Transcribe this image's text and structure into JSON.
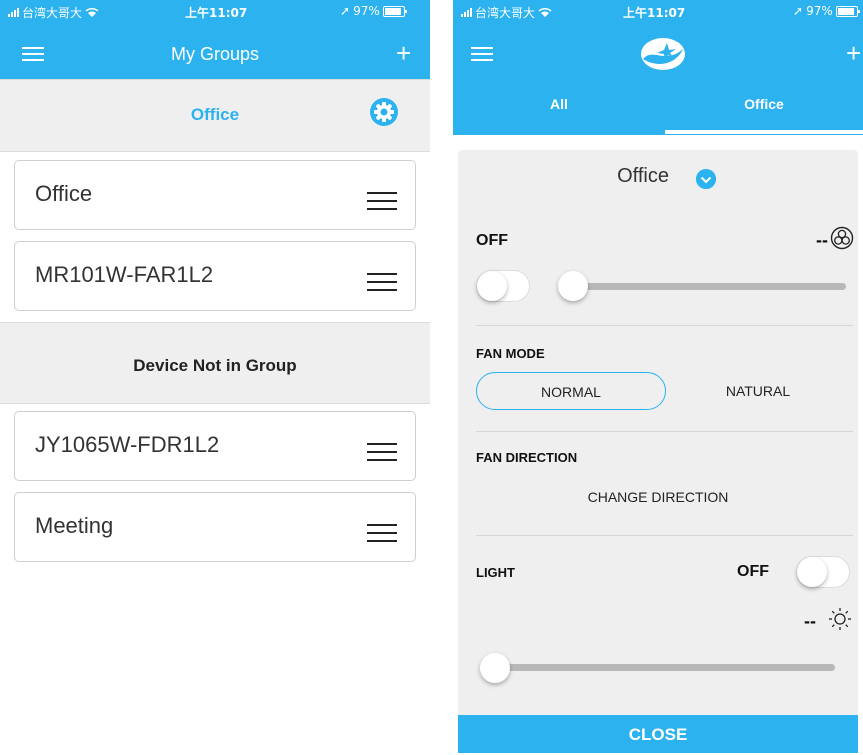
{
  "left_screen": {
    "status_bar": {
      "carrier": "台湾大哥大",
      "time": "上午11:07",
      "battery": "97%"
    },
    "header": {
      "title": "My Groups",
      "menu_icon": "hamburger-icon",
      "add_icon": "plus-icon"
    },
    "group_section": {
      "title": "Office",
      "settings_icon": "gear-icon"
    },
    "group_devices": [
      {
        "name": "Office"
      },
      {
        "name": "MR101W-FAR1L2"
      }
    ],
    "ungrouped_section": {
      "title": "Device Not in Group"
    },
    "ungrouped_devices": [
      {
        "name": "JY1065W-FDR1L2"
      },
      {
        "name": "Meeting"
      }
    ]
  },
  "right_screen": {
    "status_bar": {
      "carrier": "台湾大哥大",
      "time": "上午11:07",
      "battery": "97%"
    },
    "header": {
      "logo_icon": "brand-logo-icon",
      "menu_icon": "hamburger-icon",
      "add_icon": "plus-icon"
    },
    "tabs": [
      {
        "label": "All",
        "selected": false
      },
      {
        "label": "Office",
        "selected": true
      }
    ],
    "panel": {
      "group_title": "Office",
      "fan": {
        "status": "OFF",
        "speed_value": "--",
        "icon": "fan-icon",
        "toggle_on": false,
        "speed_fraction": 0
      },
      "fan_mode": {
        "label": "FAN MODE",
        "options": [
          "NORMAL",
          "NATURAL"
        ],
        "selected": "NORMAL"
      },
      "fan_direction": {
        "label": "FAN DIRECTION",
        "button": "CHANGE DIRECTION"
      },
      "light": {
        "label": "LIGHT",
        "status": "OFF",
        "toggle_on": false,
        "brightness_value": "--",
        "icon": "sun-icon",
        "brightness_fraction": 0
      }
    },
    "close_label": "CLOSE"
  },
  "colors": {
    "accent": "#2bb2ef",
    "section_bg": "#efefef",
    "panel_bg": "#efefef"
  }
}
